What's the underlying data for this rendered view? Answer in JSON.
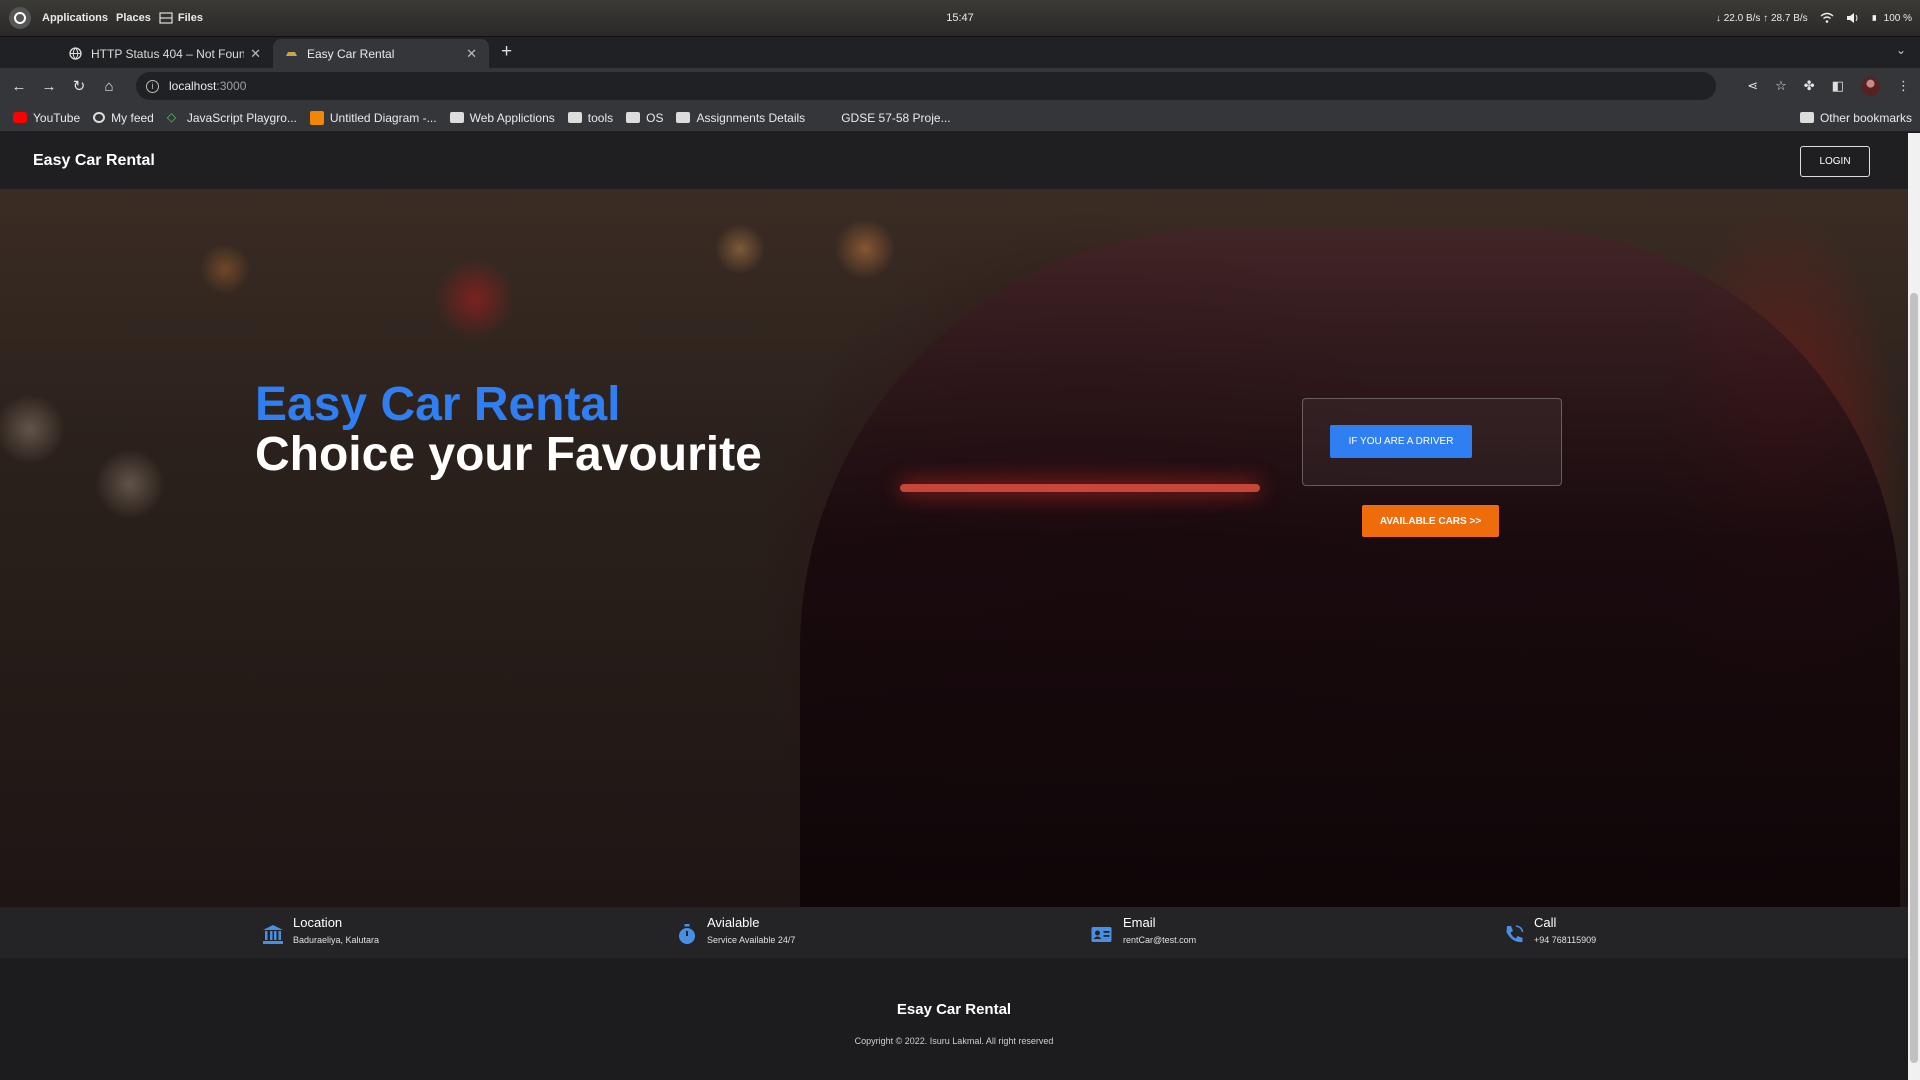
{
  "os": {
    "menu": [
      "Applications",
      "Places"
    ],
    "files_label": "Files",
    "clock": "15:47",
    "net_speed": "↓ 22.0 B/s ↑ 28.7 B/s",
    "battery": "100 %"
  },
  "browser": {
    "tabs": [
      {
        "title": "HTTP Status 404 – Not Found",
        "active": false
      },
      {
        "title": "Easy Car Rental",
        "active": true
      }
    ],
    "url_host": "localhost",
    "url_port": ":3000",
    "bookmarks": [
      {
        "label": "YouTube",
        "icon": "youtube-icon"
      },
      {
        "label": "My feed",
        "icon": "daily-dev-icon"
      },
      {
        "label": "JavaScript Playgro...",
        "icon": "code-icon"
      },
      {
        "label": "Untitled Diagram -...",
        "icon": "drawio-icon"
      },
      {
        "label": "Web Applictions",
        "icon": "folder-icon"
      },
      {
        "label": "tools",
        "icon": "folder-icon"
      },
      {
        "label": "OS",
        "icon": "folder-icon"
      },
      {
        "label": "Assignments Details",
        "icon": "folder-icon"
      },
      {
        "label": "GDSE 57-58 Proje...",
        "icon": "none"
      }
    ],
    "other_bookmarks": "Other bookmarks"
  },
  "site": {
    "brand": "Easy Car Rental",
    "login_label": "LOGIN",
    "hero_title_1": "Easy Car Rental",
    "hero_title_2": "Choice your Favourite",
    "driver_btn_label": "IF YOU ARE A DRIVER",
    "cars_btn_label": "AVAILABLE CARS >>",
    "info": [
      {
        "title": "Location",
        "sub": "Baduraeliya, Kalutara",
        "icon": "bank-icon"
      },
      {
        "title": "Avialable",
        "sub": "Service Available 24/7",
        "icon": "stopwatch-icon"
      },
      {
        "title": "Email",
        "sub": "rentCar@test.com",
        "icon": "contact-card-icon"
      },
      {
        "title": "Call",
        "sub": "+94 768115909",
        "icon": "phone-icon"
      }
    ],
    "footer_brand": "Esay Car Rental",
    "footer_copy": "Copyright © 2022. Isuru Lakmal. All right reserved"
  },
  "colors": {
    "accent_blue": "#2f7ef2",
    "accent_orange": "#ef6c0d"
  }
}
